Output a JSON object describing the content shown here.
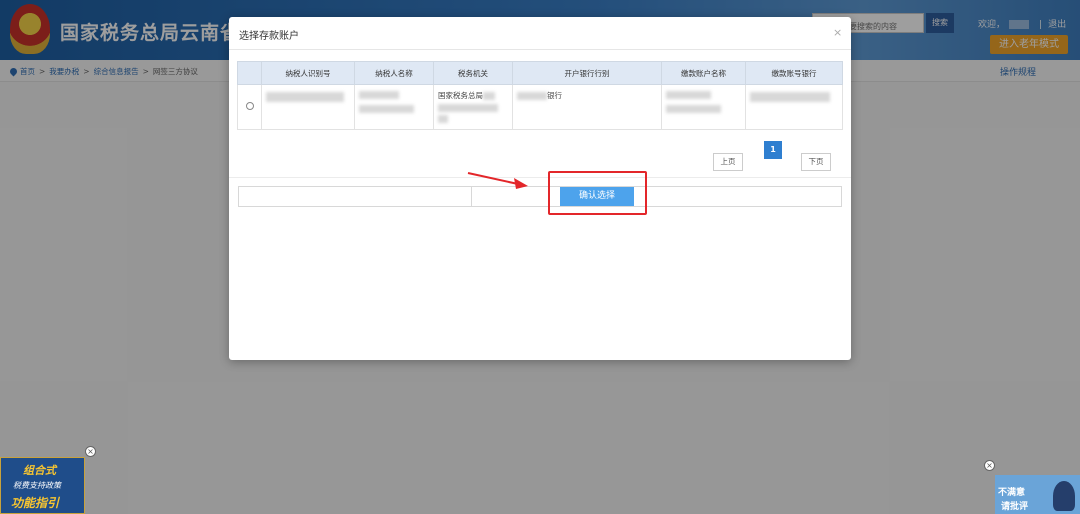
{
  "header": {
    "site_title": "国家税务总局云南省电",
    "search_placeholder": "要搜索的内容",
    "search_btn": "搜索",
    "welcome": "欢迎，",
    "separator": "|",
    "logout": "退出",
    "elder_mode": "进入老年模式"
  },
  "breadcrumb": {
    "items": [
      "首页",
      "我要办税",
      "综合信息报告",
      "网签三方协议"
    ],
    "separator": ">"
  },
  "op_rule": "操作规程",
  "modal": {
    "title": "选择存款账户",
    "close": "×",
    "columns": [
      "纳税人识别号",
      "纳税人名称",
      "税务机关",
      "开户银行行别",
      "缴款账户名称",
      "缴款账号银行"
    ],
    "rows": [
      {
        "tax_office": "国家税务总局",
        "bank": "银行"
      }
    ],
    "pager": {
      "prev": "上页",
      "current": "1",
      "next": "下页"
    },
    "confirm": "确认选择"
  },
  "ads": {
    "left": {
      "line1": "组合式",
      "line2": "税费支持政策",
      "line3": "功能指引"
    },
    "right": {
      "line1": "不满意",
      "line2": "请批评"
    },
    "close": "×"
  },
  "colors": {
    "primary": "#2f7fd0",
    "highlight": "#e3262a",
    "confirm": "#4da3ec",
    "elder": "#f0a52a"
  }
}
